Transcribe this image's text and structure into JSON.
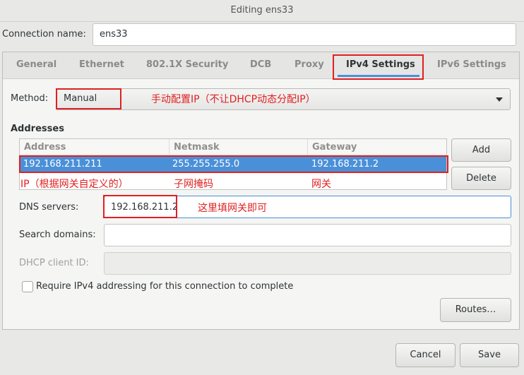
{
  "window": {
    "title": "Editing ens33"
  },
  "connection": {
    "label": "Connection name:",
    "value": "ens33"
  },
  "tabs": [
    {
      "label": "General"
    },
    {
      "label": "Ethernet"
    },
    {
      "label": "802.1X Security"
    },
    {
      "label": "DCB"
    },
    {
      "label": "Proxy"
    },
    {
      "label": "IPv4 Settings"
    },
    {
      "label": "IPv6 Settings"
    }
  ],
  "active_tab": "IPv4 Settings",
  "method": {
    "label": "Method:",
    "value": "Manual",
    "annotation": "手动配置IP（不让DHCP动态分配IP）"
  },
  "addresses": {
    "title": "Addresses",
    "columns": [
      "Address",
      "Netmask",
      "Gateway"
    ],
    "row": {
      "address": "192.168.211.211",
      "netmask": "255.255.255.0",
      "gateway": "192.168.211.2"
    },
    "annotations": {
      "address": "IP（根据网关自定义的）",
      "netmask": "子网掩码",
      "gateway": "网关"
    },
    "add_label": "Add",
    "delete_label": "Delete"
  },
  "dns": {
    "label": "DNS servers:",
    "value": "192.168.211.2",
    "annotation": "这里填网关即可"
  },
  "search_domains": {
    "label": "Search domains:",
    "value": ""
  },
  "dhcp_client_id": {
    "label": "DHCP client ID:",
    "value": ""
  },
  "require_ipv4": {
    "label": "Require IPv4 addressing for this connection to complete",
    "checked": false
  },
  "routes_label": "Routes…",
  "footer": {
    "cancel_label": "Cancel",
    "save_label": "Save"
  },
  "colors": {
    "accent": "#4a90d9",
    "annotation": "#e02020"
  }
}
